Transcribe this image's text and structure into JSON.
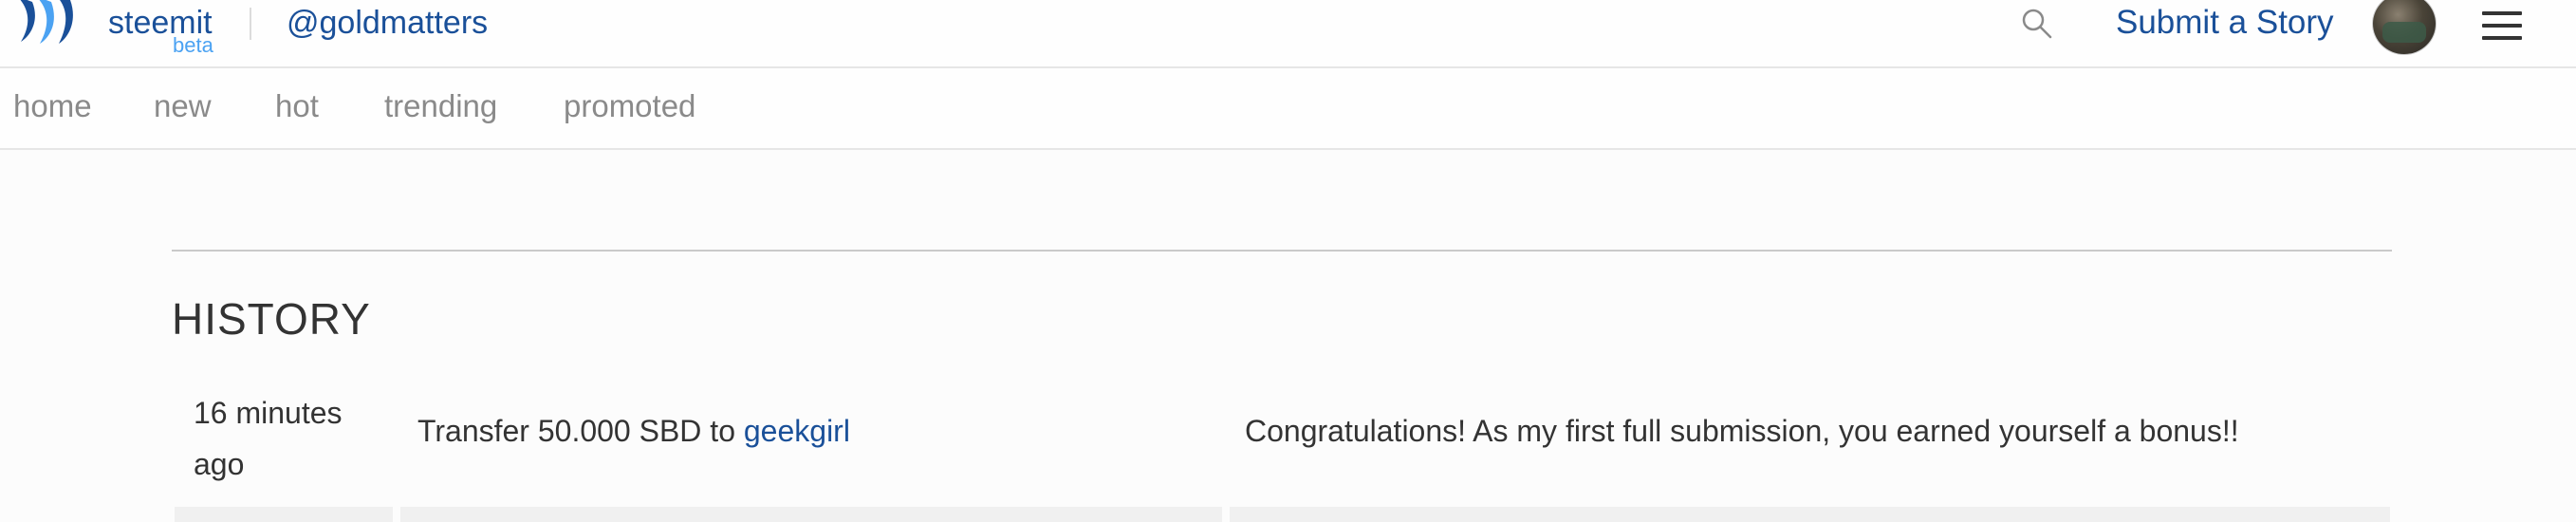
{
  "header": {
    "brand": "steemit",
    "beta": "beta",
    "username": "@goldmatters",
    "submit_label": "Submit a Story",
    "brand_color": "#1a5099",
    "beta_color": "#4ba2f2",
    "icons": [
      "steemit-logo-icon",
      "search-icon",
      "avatar",
      "menu-icon"
    ]
  },
  "subnav": {
    "items": [
      {
        "label": "home"
      },
      {
        "label": "new"
      },
      {
        "label": "hot"
      },
      {
        "label": "trending"
      },
      {
        "label": "promoted"
      }
    ]
  },
  "history": {
    "title": "HISTORY",
    "rows": [
      {
        "time": "16 minutes ago",
        "op_prefix": "Transfer 50.000 SBD to ",
        "op_link": "geekgirl",
        "memo": "Congratulations! As my first full submission, you earned yourself a bonus!!"
      }
    ]
  }
}
